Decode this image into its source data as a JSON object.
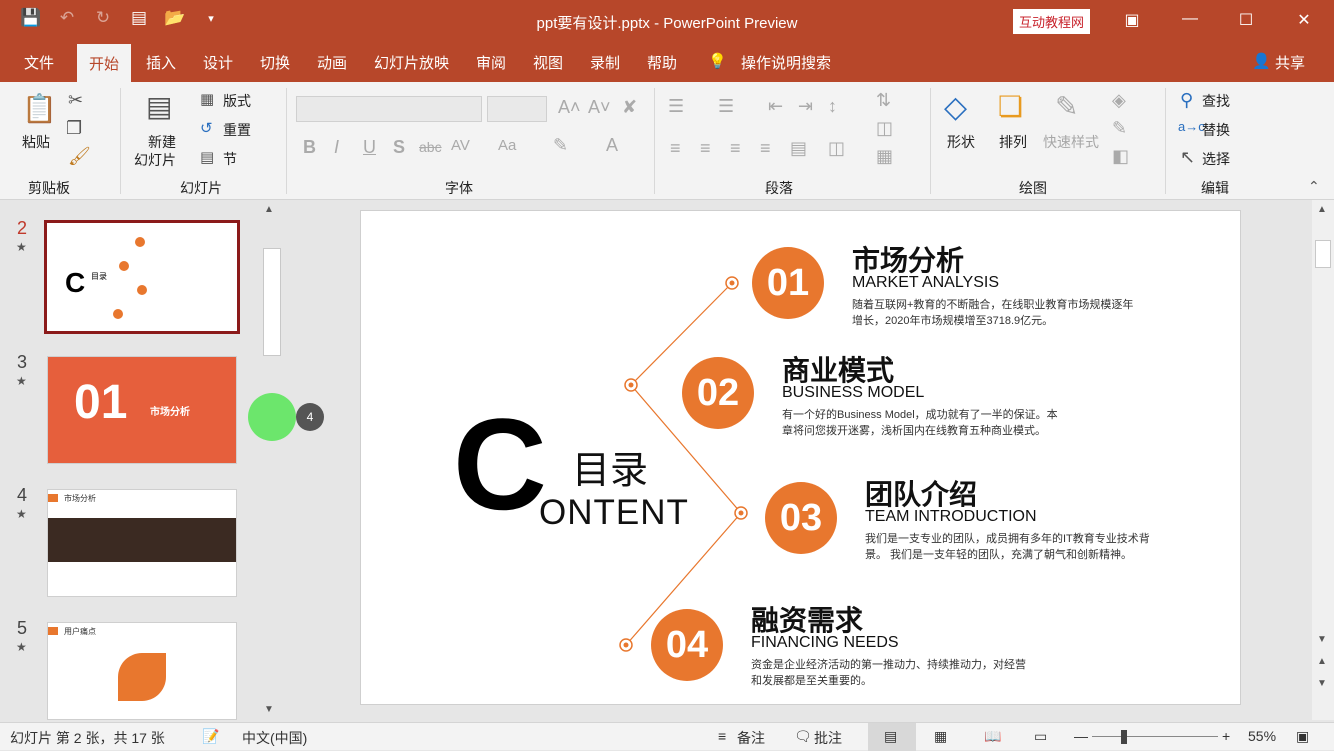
{
  "titlebar": {
    "doc_title": "ppt要有设计.pptx  -  PowerPoint Preview",
    "badge": "互动教程网"
  },
  "tabs": [
    "文件",
    "开始",
    "插入",
    "设计",
    "切换",
    "动画",
    "幻灯片放映",
    "审阅",
    "视图",
    "录制",
    "帮助"
  ],
  "active_tab": "开始",
  "tell_me": "操作说明搜索",
  "share": "共享",
  "ribbon": {
    "clipboard": {
      "paste": "粘贴",
      "group": "剪贴板"
    },
    "slides": {
      "new_slide_1": "新建",
      "new_slide_2": "幻灯片",
      "layout": "版式",
      "reset": "重置",
      "section": "节",
      "group": "幻灯片"
    },
    "font": {
      "group": "字体"
    },
    "paragraph": {
      "group": "段落"
    },
    "drawing": {
      "shapes": "形状",
      "arrange": "排列",
      "quick_styles": "快速样式",
      "group": "绘图"
    },
    "editing": {
      "find": "查找",
      "replace": "替换",
      "select": "选择",
      "group": "编辑"
    }
  },
  "thumbnails": [
    {
      "num": "2",
      "selected": true
    },
    {
      "num": "3",
      "big": "01",
      "title": "市场分析"
    },
    {
      "num": "4",
      "header": "市场分析"
    },
    {
      "num": "5",
      "header": "用户痛点"
    }
  ],
  "cursor_badge": "4",
  "slide": {
    "big_c": "C",
    "mulu": "目录",
    "ontent": "ONTENT",
    "items": [
      {
        "num": "01",
        "cn": "市场分析",
        "en": "MARKET ANALYSIS",
        "desc1": "随着互联网+教育的不断融合，在线职业教育市场规模逐年",
        "desc2": "增长，2020年市场规模增至3718.9亿元。"
      },
      {
        "num": "02",
        "cn": "商业模式",
        "en": "BUSINESS MODEL",
        "desc1": "有一个好的Business Model，成功就有了一半的保证。本",
        "desc2": "章将问您拨开迷雾，浅析国内在线教育五种商业模式。"
      },
      {
        "num": "03",
        "cn": "团队介绍",
        "en": "TEAM INTRODUCTION",
        "desc1": "我们是一支专业的团队，成员拥有多年的IT教育专业技术背",
        "desc2": "景。 我们是一支年轻的团队，充满了朝气和创新精神。"
      },
      {
        "num": "04",
        "cn": "融资需求",
        "en": "FINANCING NEEDS",
        "desc1": "资金是企业经济活动的第一推动力、持续推动力，对经营",
        "desc2": "和发展都是至关重要的。"
      }
    ],
    "accent": "#e8772e"
  },
  "status": {
    "slide_info": "幻灯片 第 2 张，共 17 张",
    "language": "中文(中国)",
    "notes": "备注",
    "comments": "批注",
    "zoom": "55%"
  }
}
